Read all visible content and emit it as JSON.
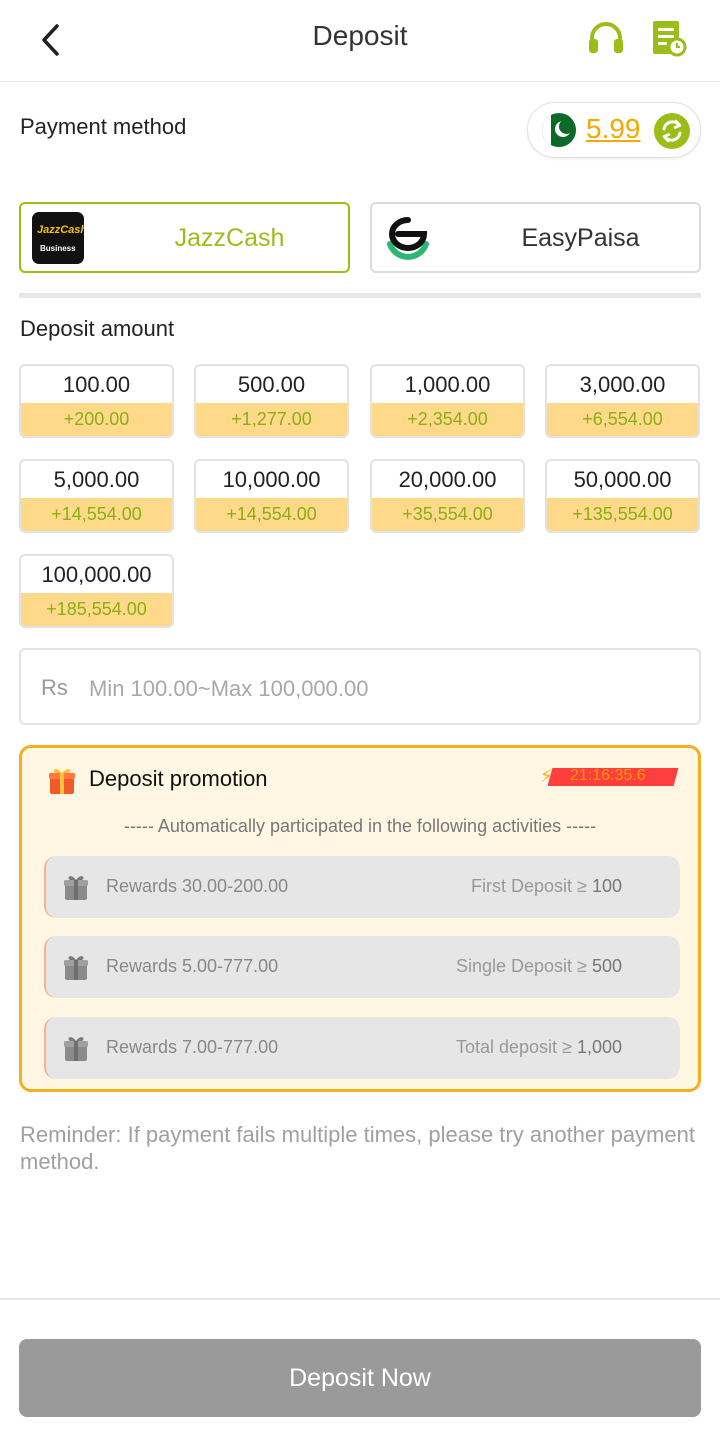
{
  "header": {
    "title": "Deposit",
    "back_icon": "chevron-left-icon",
    "support_icon": "headphones-icon",
    "record_icon": "document-clock-icon"
  },
  "payment": {
    "label": "Payment method",
    "balance": "5.99",
    "methods": [
      {
        "name": "JazzCash",
        "logo_text": "JazzCash",
        "logo_sub": "Business",
        "selected": true
      },
      {
        "name": "EasyPaisa",
        "selected": false
      }
    ]
  },
  "deposit": {
    "label": "Deposit amount",
    "amounts": [
      {
        "value": "100.00",
        "bonus": "+200.00"
      },
      {
        "value": "500.00",
        "bonus": "+1,277.00"
      },
      {
        "value": "1,000.00",
        "bonus": "+2,354.00"
      },
      {
        "value": "3,000.00",
        "bonus": "+6,554.00"
      },
      {
        "value": "5,000.00",
        "bonus": "+14,554.00"
      },
      {
        "value": "10,000.00",
        "bonus": "+14,554.00"
      },
      {
        "value": "20,000.00",
        "bonus": "+35,554.00"
      },
      {
        "value": "50,000.00",
        "bonus": "+135,554.00"
      },
      {
        "value": "100,000.00",
        "bonus": "+185,554.00"
      }
    ],
    "currency": "Rs",
    "placeholder": "Min 100.00~Max 100,000.00"
  },
  "promotion": {
    "title": "Deposit promotion",
    "timer": "21:16:35.6",
    "auto_text": "----- Automatically participated in the following activities -----",
    "rewards": [
      {
        "reward": "Rewards 30.00-200.00",
        "condition": "First Deposit ≥",
        "threshold": "100"
      },
      {
        "reward": "Rewards 5.00-777.00",
        "condition": "Single Deposit ≥",
        "threshold": "500"
      },
      {
        "reward": "Rewards 7.00-777.00",
        "condition": "Total deposit ≥",
        "threshold": "1,000"
      }
    ]
  },
  "reminder": "Reminder: If payment fails multiple times, please try another payment method.",
  "button": {
    "label": "Deposit Now"
  },
  "colors": {
    "accent": "#9bbd17",
    "gold": "#f2a900",
    "bonus_bg": "#ffd98a",
    "promo_border": "#f2b01e",
    "button_disabled": "#9a9a9a"
  }
}
